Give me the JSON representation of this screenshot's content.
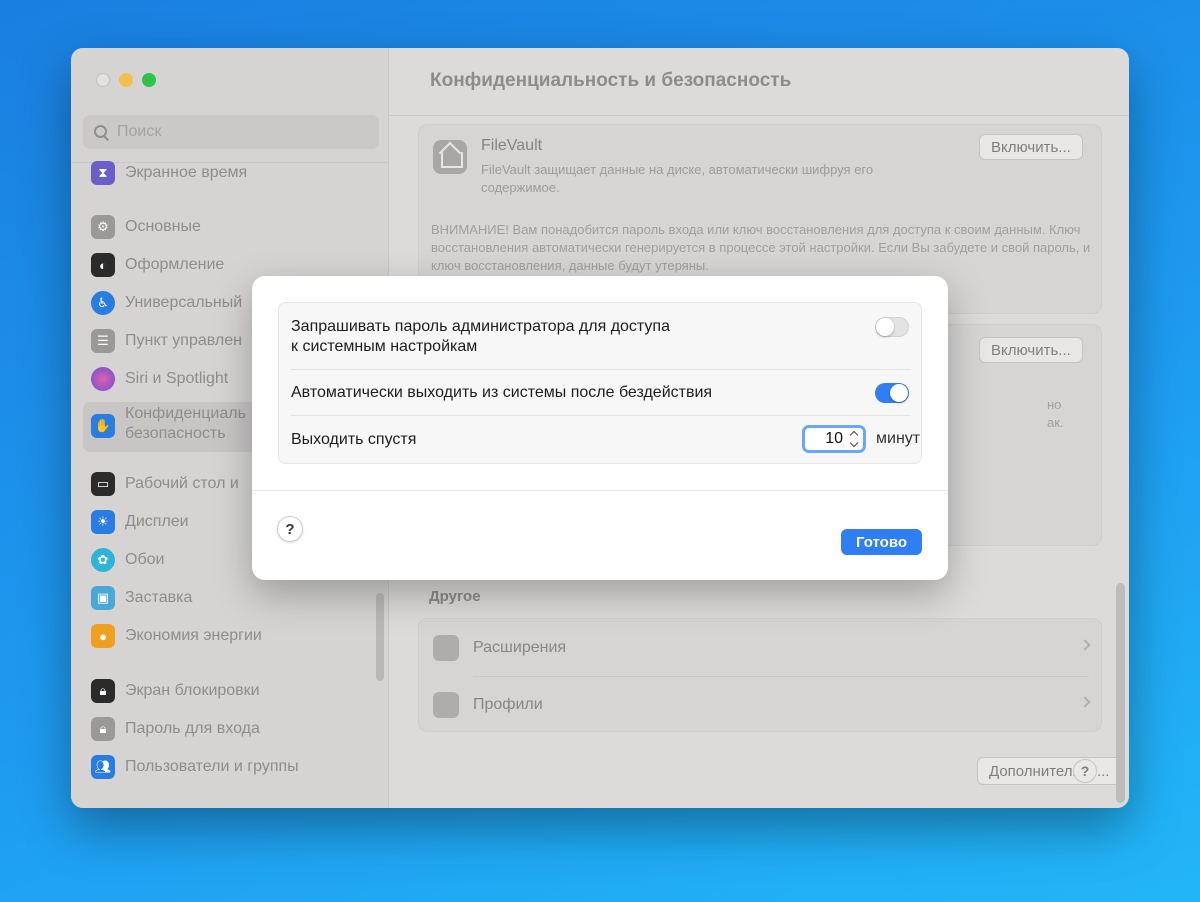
{
  "window": {
    "title": "Конфиденциальность и безопасность"
  },
  "sidebar": {
    "search_placeholder": "Поиск",
    "items": [
      {
        "label": "Экранное время",
        "icon": "hourglass-icon",
        "color": "#6a5fc7"
      },
      {
        "label": "Основные",
        "icon": "gear-icon",
        "color": "#9a9998"
      },
      {
        "label": "Оформление",
        "icon": "appearance-icon",
        "color": "#2b2b2b"
      },
      {
        "label": "Универсальный",
        "icon": "accessibility-icon",
        "color": "#2a7de0"
      },
      {
        "label": "Пункт управлен",
        "icon": "control-center-icon",
        "color": "#9a9998"
      },
      {
        "label": "Siri и Spotlight",
        "icon": "siri-icon",
        "color": "#8a4fd0"
      },
      {
        "label": "Конфиденциаль",
        "label2": "безопасность",
        "icon": "hand-icon",
        "color": "#2a7de0"
      },
      {
        "label": "Рабочий стол и",
        "icon": "desktop-icon",
        "color": "#2b2b2b"
      },
      {
        "label": "Дисплеи",
        "icon": "sun-icon",
        "color": "#2a7de0"
      },
      {
        "label": "Обои",
        "icon": "flower-icon",
        "color": "#2fb4d8"
      },
      {
        "label": "Заставка",
        "icon": "screensaver-icon",
        "color": "#4aa8d8"
      },
      {
        "label": "Экономия энергии",
        "icon": "lightbulb-icon",
        "color": "#f0a020"
      },
      {
        "label": "Экран блокировки",
        "icon": "lock-icon",
        "color": "#2b2b2b"
      },
      {
        "label": "Пароль для входа",
        "icon": "lock-icon",
        "color": "#9a9998"
      },
      {
        "label": "Пользователи и группы",
        "icon": "users-icon",
        "color": "#2a7de0"
      }
    ]
  },
  "content": {
    "filevault": {
      "title": "FileVault",
      "description": "FileVault защищает данные на диске, автоматически шифруя его содержимое.",
      "button": "Включить...",
      "warning": "ВНИМАНИЕ! Вам понадобится пароль входа или ключ восстановления для доступа к своим данным. Ключ восстановления автоматически генерируется в процессе этой настройки. Если Вы забудете и свой пароль, и ключ восстановления, данные будут утеряны."
    },
    "lockdown": {
      "button": "Включить...",
      "partial1": "но",
      "partial2": "ак."
    },
    "other": {
      "heading": "Другое",
      "rows": [
        {
          "label": "Расширения",
          "icon": "extensions-icon"
        },
        {
          "label": "Профили",
          "icon": "profiles-icon"
        }
      ]
    },
    "advanced_button": "Дополнительно...",
    "help": "?"
  },
  "dialog": {
    "row1_line1": "Запрашивать пароль администратора для доступа",
    "row1_line2": "к системным настройкам",
    "row1_enabled": false,
    "row2_label": "Автоматически выходить из системы после бездействия",
    "row2_enabled": true,
    "row3_label": "Выходить спустя",
    "stepper_value": "10",
    "unit": "минут",
    "help": "?",
    "done_button": "Готово",
    "accent": "#2f7ef2"
  }
}
